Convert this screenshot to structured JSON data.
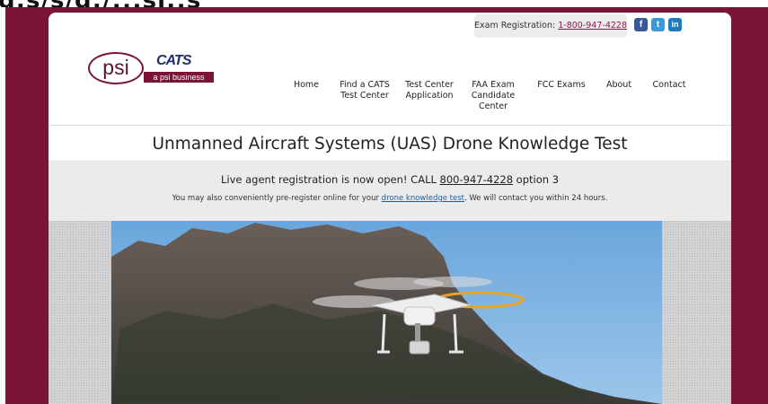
{
  "cut_text": "g:s/s/g:/;;;sj:;s",
  "header": {
    "exam_registration_label": "Exam Registration: ",
    "exam_registration_phone": "1-800-947-4228",
    "social": {
      "facebook": "f",
      "twitter": "t",
      "linkedin": "in"
    }
  },
  "logo": {
    "psi": "psi",
    "cats": "CATS",
    "sub": "a psi business"
  },
  "nav": {
    "items": [
      {
        "label": "Home"
      },
      {
        "label": "Find a CATS\nTest Center"
      },
      {
        "label": "Test Center\nApplication"
      },
      {
        "label": "FAA Exam\nCandidate\nCenter"
      },
      {
        "label": "FCC Exams"
      },
      {
        "label": "About"
      },
      {
        "label": "Contact"
      }
    ]
  },
  "page": {
    "title": "Unmanned Aircraft Systems (UAS) Drone Knowledge Test"
  },
  "notice": {
    "line1_prefix": "Live agent registration is now open! CALL ",
    "line1_phone": "800-947-4228",
    "line1_suffix": " option 3",
    "line2_prefix": "You may also conveniently pre-register online for your ",
    "line2_link": "drone knowledge test",
    "line2_suffix": ". We will contact you within 24 hours."
  },
  "colors": {
    "brand_maroon": "#7a1538",
    "link_maroon": "#8b1a4a",
    "link_blue": "#1a5fa8",
    "sky": "#7fb2df"
  }
}
